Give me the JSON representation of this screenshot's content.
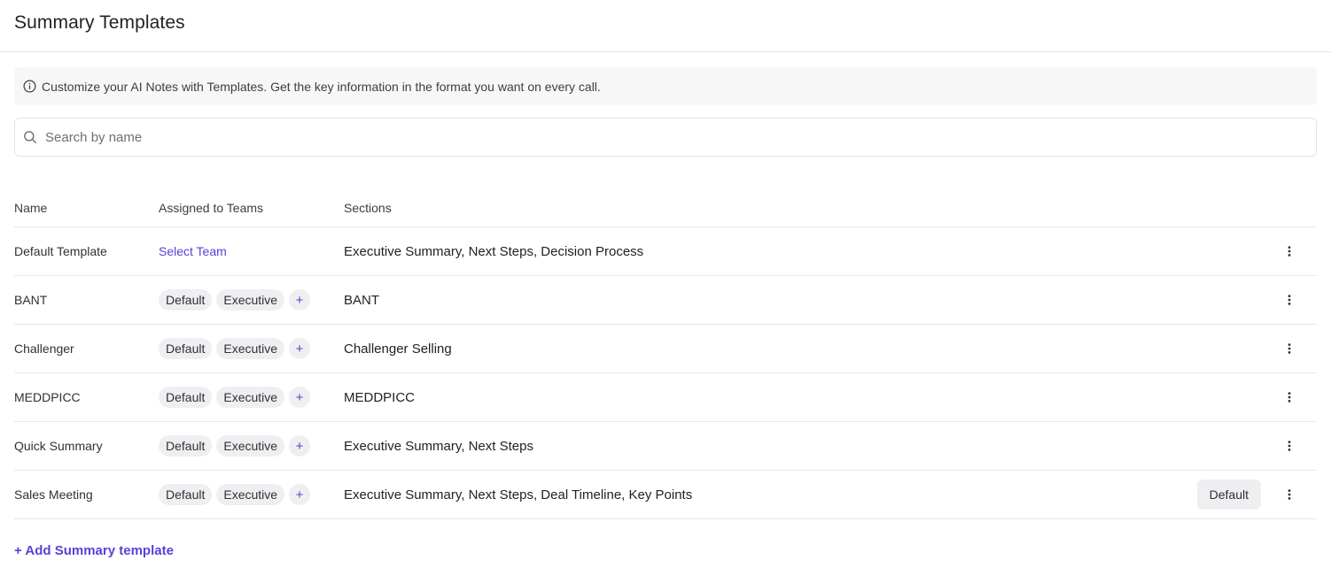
{
  "page": {
    "title": "Summary Templates"
  },
  "banner": {
    "text": "Customize your AI Notes with Templates. Get the key information in the format you want on every call.",
    "icon": "info-icon"
  },
  "search": {
    "placeholder": "Search by name",
    "value": "",
    "icon": "search-icon"
  },
  "table": {
    "columns": {
      "name": "Name",
      "teams": "Assigned to Teams",
      "sections": "Sections"
    },
    "rows": [
      {
        "name": "Default Template",
        "team_link": "Select Team",
        "teams": [],
        "sections": "Executive Summary, Next Steps, Decision Process",
        "default_badge": ""
      },
      {
        "name": "BANT",
        "team_link": "",
        "teams": [
          "Default",
          "Executive"
        ],
        "sections": "BANT",
        "default_badge": ""
      },
      {
        "name": "Challenger",
        "team_link": "",
        "teams": [
          "Default",
          "Executive"
        ],
        "sections": "Challenger Selling",
        "default_badge": ""
      },
      {
        "name": "MEDDPICC",
        "team_link": "",
        "teams": [
          "Default",
          "Executive"
        ],
        "sections": "MEDDPICC",
        "default_badge": ""
      },
      {
        "name": "Quick Summary",
        "team_link": "",
        "teams": [
          "Default",
          "Executive"
        ],
        "sections": "Executive Summary, Next Steps",
        "default_badge": ""
      },
      {
        "name": "Sales Meeting",
        "team_link": "",
        "teams": [
          "Default",
          "Executive"
        ],
        "sections": "Executive Summary, Next Steps, Deal Timeline, Key Points",
        "default_badge": "Default"
      }
    ],
    "add_team_symbol": "+",
    "row_menu_icon": "kebab-menu-icon"
  },
  "add_template": {
    "label": "+ Add Summary template"
  },
  "colors": {
    "accent": "#5b3fd6",
    "chip_bg": "#efeff1",
    "border": "#e6e7ea",
    "banner_bg": "#f7f7f8"
  }
}
